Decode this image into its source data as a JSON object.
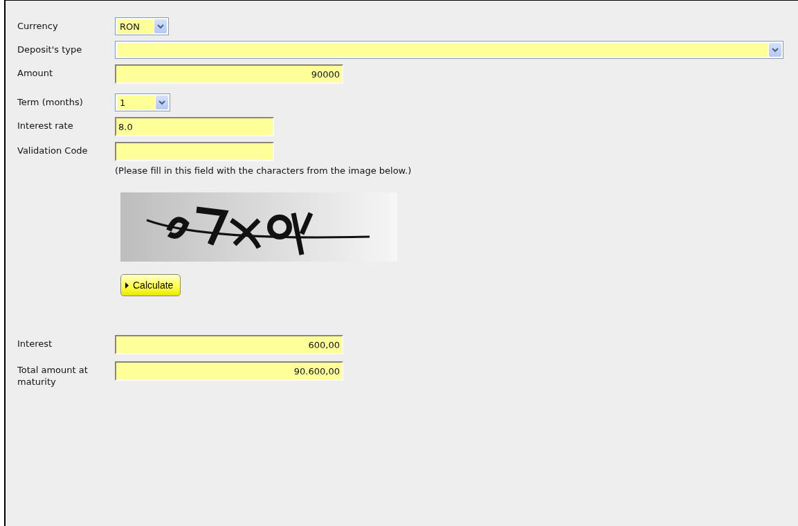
{
  "fields": [
    {
      "label": "Currency",
      "kind": "select",
      "value": "RON"
    },
    {
      "label": "Deposit's type",
      "kind": "select"
    },
    {
      "label": "Amount",
      "kind": "number",
      "value": "90000"
    },
    {
      "label": "Term (months)",
      "kind": "select",
      "value": "1"
    },
    {
      "label": "Interest rate",
      "kind": "text",
      "value": "8.0"
    },
    {
      "label": "Validation Code",
      "kind": "text",
      "hint": "(Please fill in this field with the characters from the image below.)"
    }
  ],
  "button": {
    "label": "Calculate"
  },
  "results": [
    {
      "label": "Interest",
      "kind": "number",
      "value": "600,00"
    },
    {
      "label": "Total amount at maturity",
      "kind": "number",
      "value": "90.600,00"
    }
  ]
}
